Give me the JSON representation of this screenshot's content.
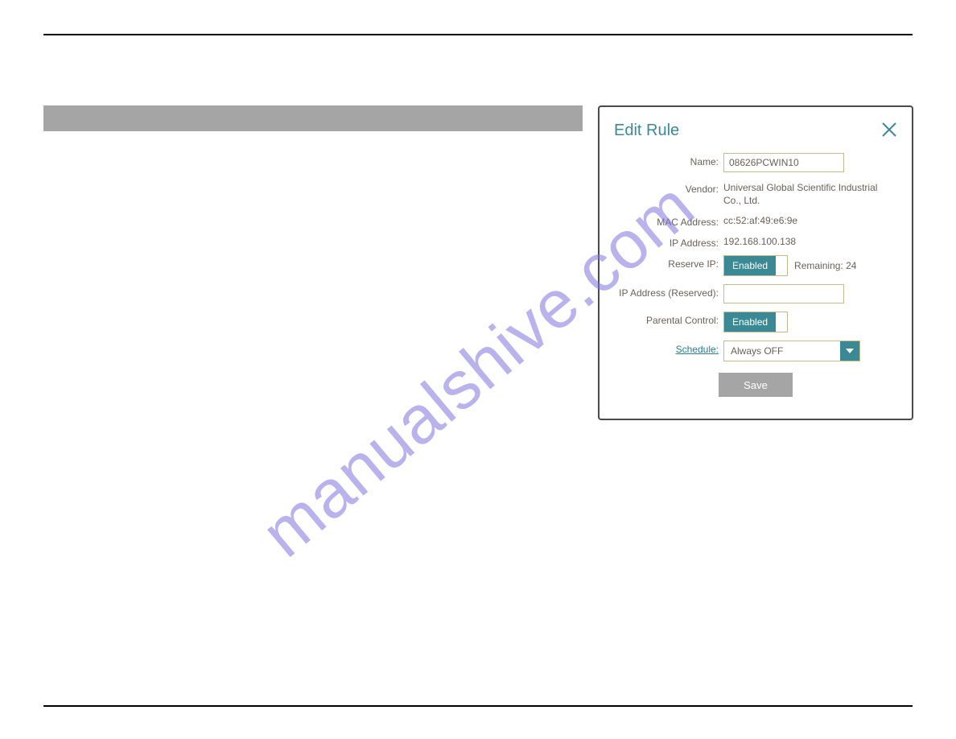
{
  "watermark": "manualshive.com",
  "dialog": {
    "title": "Edit Rule",
    "fields": {
      "name_label": "Name:",
      "name_value": "08626PCWIN10",
      "vendor_label": "Vendor:",
      "vendor_value": "Universal Global Scientific Industrial Co., Ltd.",
      "mac_label": "MAC Address:",
      "mac_value": "cc:52:af:49:e6:9e",
      "ip_label": "IP Address:",
      "ip_value": "192.168.100.138",
      "reserve_label": "Reserve IP:",
      "reserve_toggle": "Enabled",
      "remaining_label": "Remaining: 24",
      "ip_reserved_label": "IP Address (Reserved):",
      "ip_reserved_value": "",
      "parental_label": "Parental Control:",
      "parental_toggle": "Enabled",
      "schedule_label": "Schedule:",
      "schedule_value": "Always OFF",
      "save_label": "Save"
    }
  }
}
